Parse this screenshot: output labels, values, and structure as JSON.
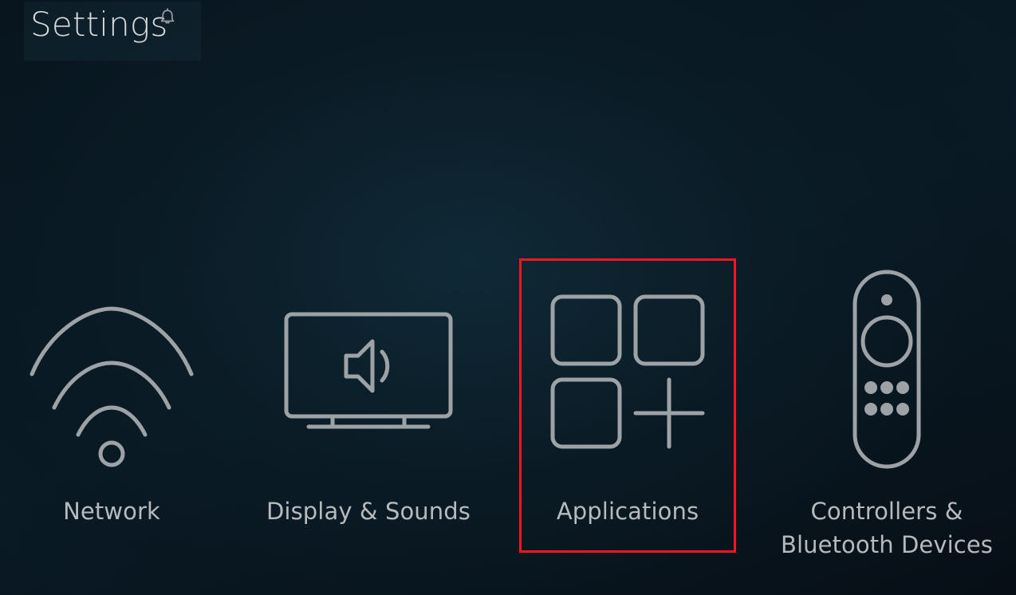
{
  "header": {
    "title": "Settings",
    "notification_icon": "bell-icon"
  },
  "theme": {
    "background_dark": "#081620",
    "background_mid": "#0a1c28",
    "icon_stroke": "#9ca2a6",
    "label_text": "#b6babd",
    "title_text": "#d7dadd",
    "highlight_border": "#fb1421"
  },
  "highlight": {
    "target": "Applications",
    "color": "#fb1421"
  },
  "tiles": [
    {
      "id": "network",
      "label": "Network",
      "label_line2": "",
      "icon": "wifi-icon"
    },
    {
      "id": "display-and-sounds",
      "label": "Display & Sounds",
      "label_line2": "",
      "icon": "tv-speaker-icon"
    },
    {
      "id": "applications",
      "label": "Applications",
      "label_line2": "",
      "icon": "app-grid-plus-icon"
    },
    {
      "id": "controllers-and-bluetooth-devices",
      "label": "Controllers &",
      "label_line2": "Bluetooth Devices",
      "icon": "remote-control-icon"
    }
  ]
}
